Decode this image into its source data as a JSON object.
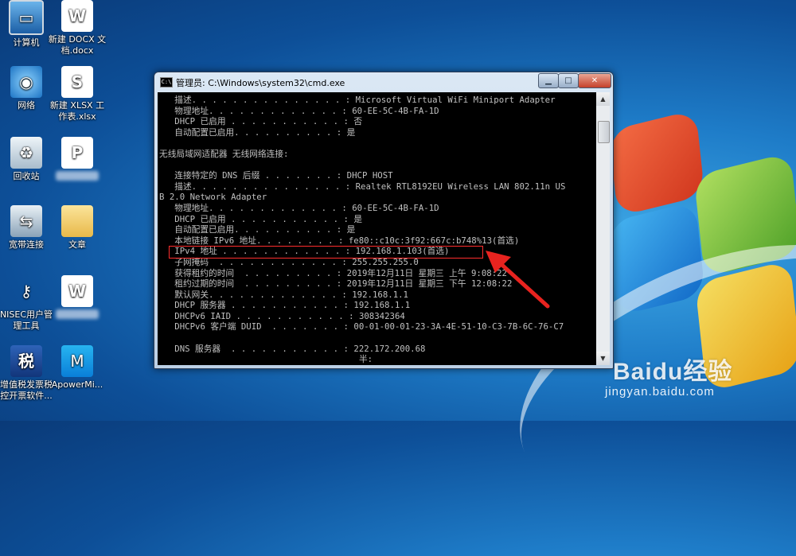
{
  "desktop": {
    "icons": [
      {
        "label": "计算机"
      },
      {
        "label": "新建 DOCX 文档.docx"
      },
      {
        "label": "网络"
      },
      {
        "label": "新建 XLSX 工作表.xlsx"
      },
      {
        "label": "回收站"
      },
      {
        "label": ""
      },
      {
        "label": "宽带连接"
      },
      {
        "label": "文章"
      },
      {
        "label": "NISEC用户管理工具"
      },
      {
        "label": ""
      },
      {
        "label": "增值税发票税控开票软件..."
      },
      {
        "label": "ApowerMi..."
      }
    ]
  },
  "window": {
    "title": "管理员: C:\\Windows\\system32\\cmd.exe",
    "controls": {
      "minimize": "▁",
      "maximize": "□",
      "close": "✕"
    }
  },
  "console": {
    "lines": [
      "   描述. . . . . . . . . . . . . . . : Microsoft Virtual WiFi Miniport Adapter",
      "   物理地址. . . . . . . . . . . . . : 60-EE-5C-4B-FA-1D",
      "   DHCP 已启用 . . . . . . . . . . . : 否",
      "   自动配置已启用. . . . . . . . . . : 是",
      "",
      "无线局域网适配器 无线网络连接:",
      "",
      "   连接特定的 DNS 后缀 . . . . . . . : DHCP HOST",
      "   描述. . . . . . . . . . . . . . . : Realtek RTL8192EU Wireless LAN 802.11n US",
      "B 2.0 Network Adapter",
      "   物理地址. . . . . . . . . . . . . : 60-EE-5C-4B-FA-1D",
      "   DHCP 已启用 . . . . . . . . . . . : 是",
      "   自动配置已启用. . . . . . . . . . : 是",
      "   本地链接 IPv6 地址. . . . . . . . : fe80::c10c:3f92:667c:b748%13(首选)",
      "   IPv4 地址 . . . . . . . . . . . . : 192.168.1.103(首选)",
      "   子网掩码  . . . . . . . . . . . . : 255.255.255.0",
      "   获得租约的时间  . . . . . . . . . : 2019年12月11日 星期三 上午 9:08:22",
      "   租约过期的时间  . . . . . . . . . : 2019年12月11日 星期三 下午 12:08:22",
      "   默认网关. . . . . . . . . . . . . : 192.168.1.1",
      "   DHCP 服务器 . . . . . . . . . . . : 192.168.1.1",
      "   DHCPv6 IAID . . . . . . . . . . . : 308342364",
      "   DHCPv6 客户端 DUID  . . . . . . . : 00-01-00-01-23-3A-4E-51-10-C3-7B-6C-76-C7",
      "",
      "   DNS 服务器  . . . . . . . . . . . : 222.172.200.68",
      "                                       半:"
    ]
  },
  "watermark": {
    "brand": "Baidu经验",
    "url": "jingyan.baidu.com"
  },
  "colors": {
    "highlight": "#ff2d2d",
    "console_text": "#c0c0c0",
    "console_bg": "#000000"
  }
}
